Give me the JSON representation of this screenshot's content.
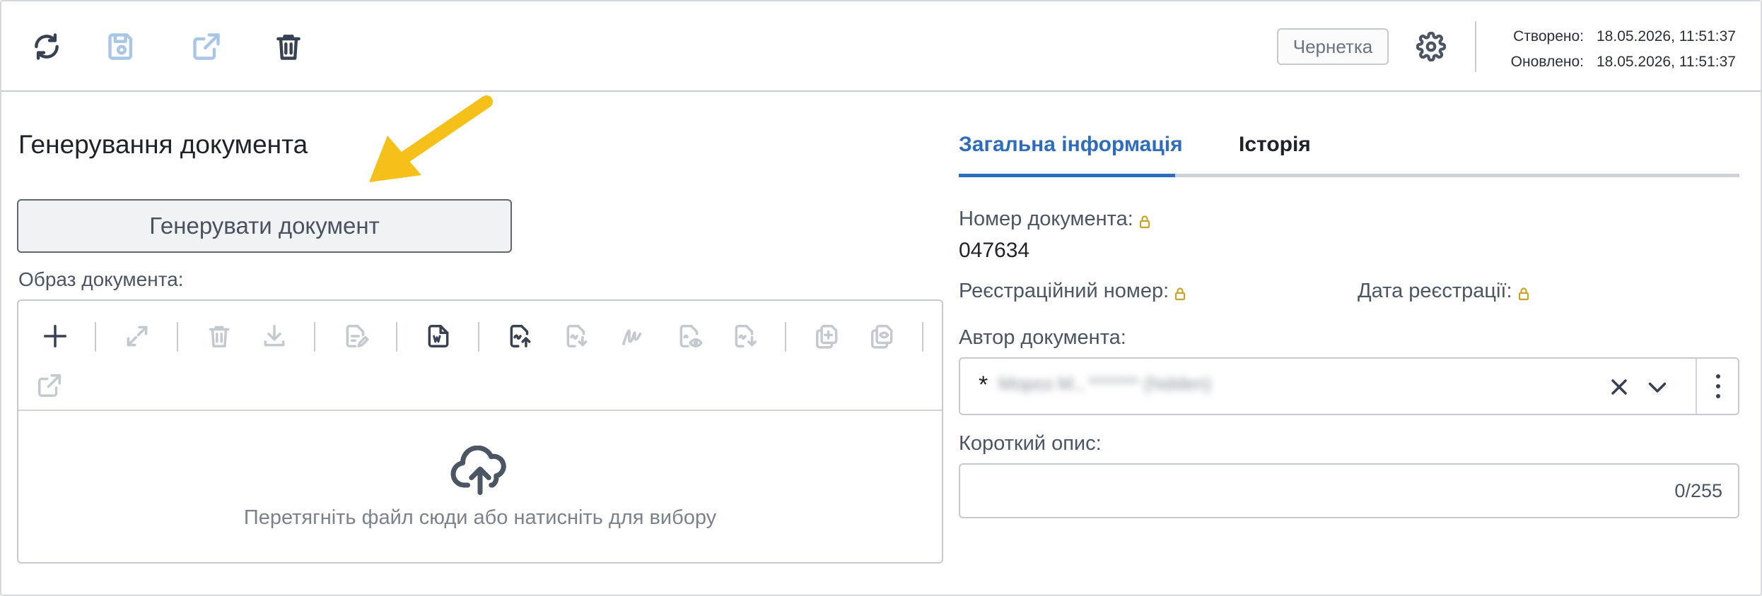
{
  "toolbar": {
    "icons": [
      "refresh-icon",
      "save-icon",
      "open-external-icon",
      "delete-icon"
    ],
    "status_badge": "Чернетка",
    "created_label": "Створено:",
    "created_value": "18.05.2026, 11:51:37",
    "updated_label": "Оновлено:",
    "updated_value": "18.05.2026, 11:51:37"
  },
  "left": {
    "section_title": "Генерування документа",
    "generate_button": "Генерувати документ",
    "image_label": "Образ документа:",
    "dropzone_text": "Перетягніть файл сюди або натисніть для вибору"
  },
  "tabs": [
    {
      "label": "Загальна інформація",
      "active": true
    },
    {
      "label": "Історія",
      "active": false
    }
  ],
  "fields": {
    "doc_number_label": "Номер документа:",
    "doc_number_value": "047634",
    "reg_number_label": "Реєстраційний номер:",
    "reg_date_label": "Дата реєстрації:",
    "author_label": "Автор документа:",
    "author_prefix": "*",
    "author_blurred": "Мороз М., ******* (hidden)",
    "short_desc_label": "Короткий опис:",
    "short_desc_value": "",
    "short_desc_counter": "0/255"
  },
  "colors": {
    "accent": "#2f6dbc",
    "lock": "#c9a227",
    "arrow": "#f5c01a"
  }
}
